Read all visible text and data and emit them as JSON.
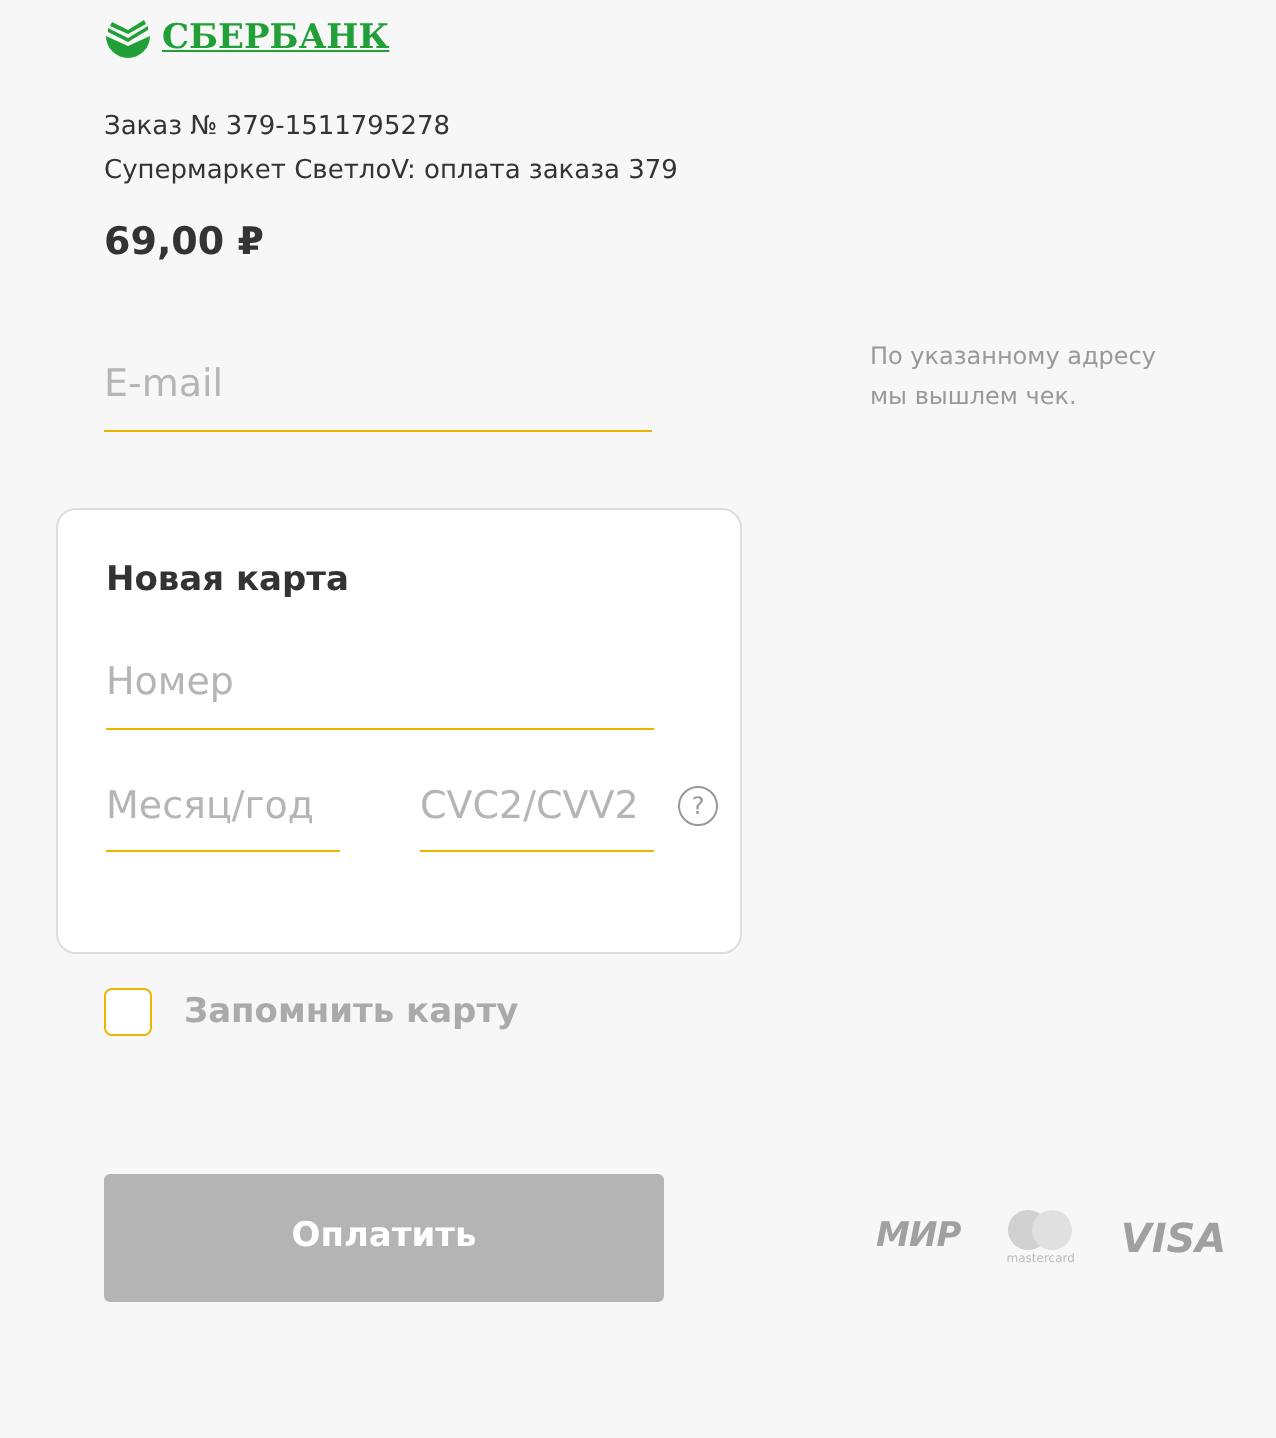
{
  "logo": {
    "text": "СБЕРБАНК"
  },
  "order": {
    "number": "Заказ № 379-1511795278",
    "description": "Супермаркет СветлоV: оплата заказа 379",
    "amount": "69,00 ₽"
  },
  "email": {
    "placeholder": "E-mail",
    "hint": "По указанному адресу мы вышлем чек."
  },
  "card": {
    "title": "Новая карта",
    "number_placeholder": "Номер",
    "expiry_placeholder": "Месяц/год",
    "cvc_placeholder": "CVC2/CVV2",
    "help": "?"
  },
  "remember": {
    "label": "Запомнить карту",
    "checked": false
  },
  "pay_button": {
    "label": "Оплатить",
    "disabled": true
  },
  "payment_logos": {
    "mir": "МИР",
    "mastercard": "mastercard",
    "visa": "VISA"
  }
}
